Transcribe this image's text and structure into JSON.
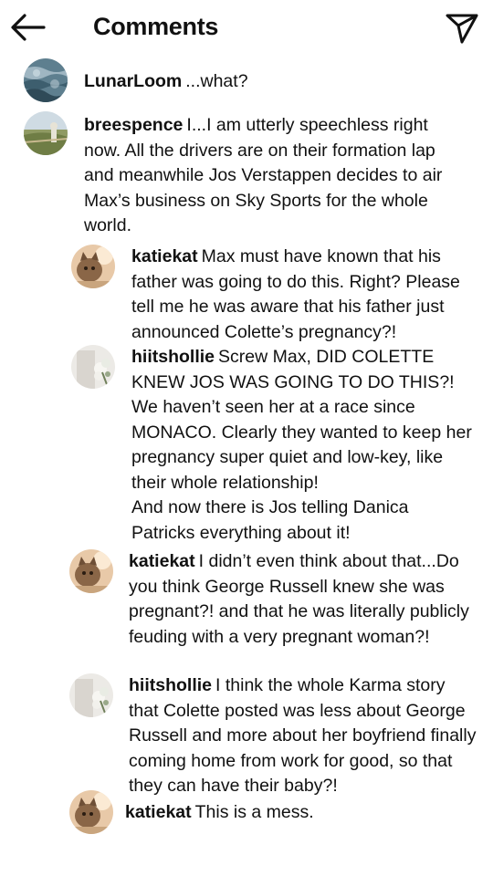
{
  "header": {
    "title": "Comments",
    "back_icon": "arrow-left-icon",
    "share_icon": "paper-plane-icon"
  },
  "comments": [
    {
      "user": "LunarLoom",
      "text": "...what?",
      "avatar": "ocean-avatar"
    },
    {
      "user": "breespence",
      "text": "I...I am utterly speechless right now. All the drivers are on their formation lap and meanwhile Jos Verstappen decides to air Max’s business on Sky Sports for the whole world.",
      "avatar": "field-avatar"
    },
    {
      "user": "katiekat",
      "text": "Max must have known that his father was going to do this. Right? Please tell me he was aware that his father just announced Colette’s pregnancy?!",
      "avatar": "cat-avatar"
    },
    {
      "user": "hiitshollie",
      "text": "Screw Max, DID COLETTE KNEW JOS WAS GOING TO DO THIS?! We haven’t seen her at a race since MONACO. Clearly they wanted to keep her pregnancy super quiet and low-key, like their whole relationship!",
      "text2": "And now there is Jos telling Danica Patricks everything about it!",
      "avatar": "bouquet-avatar"
    },
    {
      "user": "katiekat",
      "text": "I didn’t even think about that...Do you think George Russell knew she was pregnant?! and that he was literally publicly feuding with a very pregnant woman?!",
      "avatar": "cat-avatar"
    },
    {
      "user": "hiitshollie",
      "text": "I think the whole Karma story that Colette posted was less about George Russell and more about her boyfriend finally coming home from work for good, so that they can have their baby?!",
      "avatar": "bouquet-avatar"
    },
    {
      "user": "katiekat",
      "text": "This is a mess.",
      "avatar": "cat-avatar"
    }
  ]
}
